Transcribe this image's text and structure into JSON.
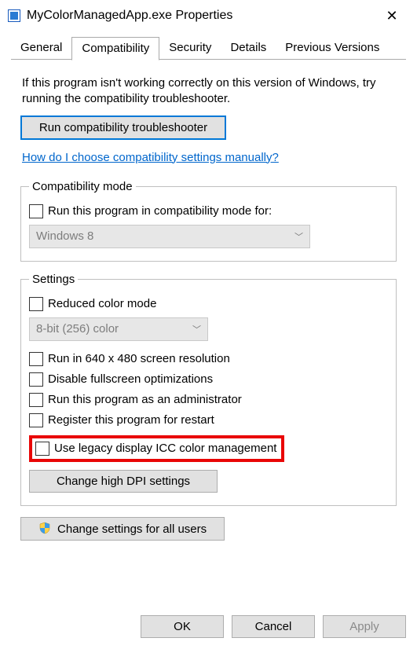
{
  "window": {
    "title": "MyColorManagedApp.exe Properties"
  },
  "tabs": {
    "general": "General",
    "compatibility": "Compatibility",
    "security": "Security",
    "details": "Details",
    "previous": "Previous Versions",
    "active": "compatibility"
  },
  "hint": "If this program isn't working correctly on this version of Windows, try running the compatibility troubleshooter.",
  "troubleshoot_btn": "Run compatibility troubleshooter",
  "help_link": "How do I choose compatibility settings manually?",
  "compat_mode": {
    "legend": "Compatibility mode",
    "checkbox": "Run this program in compatibility mode for:",
    "combo_value": "Windows 8"
  },
  "settings": {
    "legend": "Settings",
    "reduced_color": "Reduced color mode",
    "color_combo": "8-bit (256) color",
    "res640": "Run in 640 x 480 screen resolution",
    "disable_fs": "Disable fullscreen optimizations",
    "run_admin": "Run this program as an administrator",
    "register_restart": "Register this program for restart",
    "legacy_icc": "Use legacy display ICC color management",
    "dpi_btn": "Change high DPI settings"
  },
  "all_users_btn": "Change settings for all users",
  "buttons": {
    "ok": "OK",
    "cancel": "Cancel",
    "apply": "Apply"
  }
}
